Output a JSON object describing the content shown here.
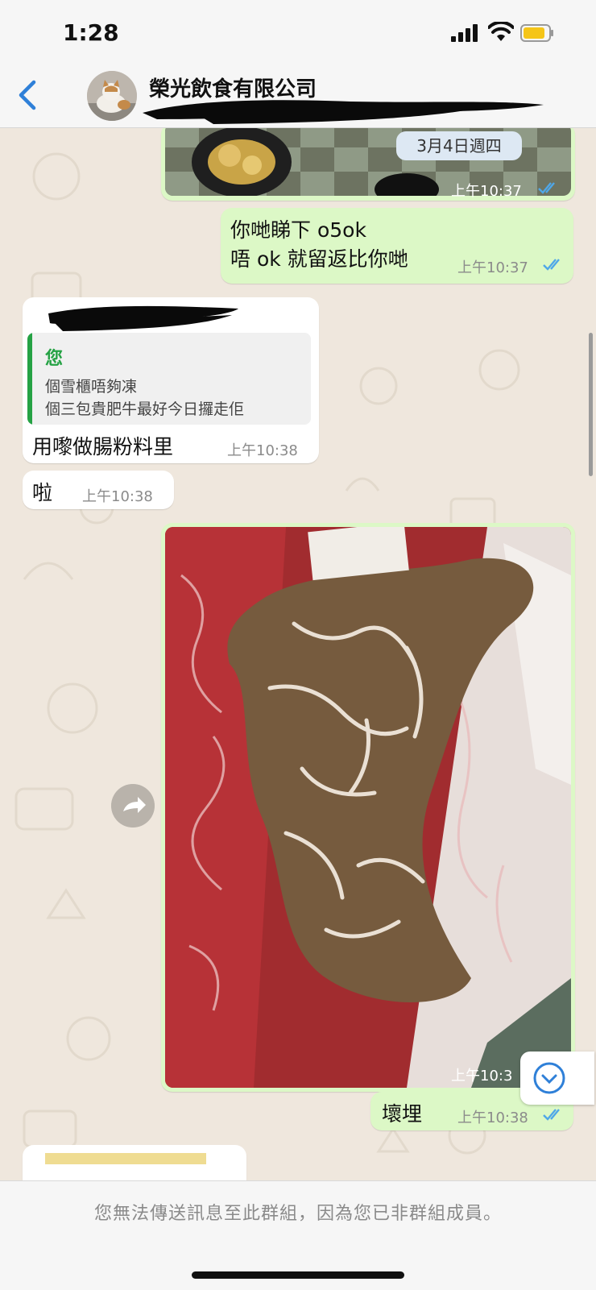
{
  "status_bar": {
    "time": "1:28"
  },
  "header": {
    "group_name": "榮光飲食有限公司"
  },
  "date_pill": "3月4日週四",
  "messages": [
    {
      "direction": "outgoing",
      "type": "image",
      "time": "上午10:37",
      "read": true
    },
    {
      "direction": "outgoing",
      "type": "text",
      "lines": [
        "你哋睇下 o5ok",
        "唔 ok 就留返比你哋"
      ],
      "time": "上午10:37",
      "read": true
    },
    {
      "direction": "incoming",
      "type": "reply",
      "quoted": {
        "author": "您",
        "lines": [
          "個雪櫃唔夠凍",
          "個三包貴肥牛最好今日攞走佢"
        ]
      },
      "text": "用嚟做腸粉料里",
      "time": "上午10:38"
    },
    {
      "direction": "incoming",
      "type": "text",
      "text": "啦",
      "time": "上午10:38"
    },
    {
      "direction": "outgoing",
      "type": "image",
      "time": "上午10:3",
      "read": true
    },
    {
      "direction": "outgoing",
      "type": "text",
      "text": "壞埋",
      "time": "上午10:38",
      "read": true
    }
  ],
  "footer": {
    "notice": "您無法傳送訊息至此群組，因為您已非群組成員。"
  },
  "colors": {
    "outgoing_bubble": "#dcf8c6",
    "incoming_bubble": "#ffffff",
    "ios_blue": "#2f80d8",
    "read_ticks": "#4fa7e8",
    "quote_green": "#25a244"
  },
  "icons": [
    "back-chevron-icon",
    "signal-icon",
    "wifi-icon",
    "battery-icon",
    "forward-icon",
    "scroll-down-icon",
    "double-check-icon"
  ]
}
